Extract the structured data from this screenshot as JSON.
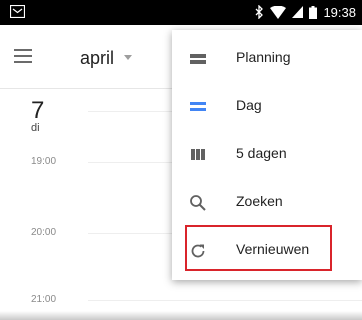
{
  "status_bar": {
    "time": "19:38"
  },
  "header": {
    "month": "april"
  },
  "calendar": {
    "day_number": "7",
    "day_name": "di",
    "times": [
      "19:00",
      "20:00",
      "21:00"
    ]
  },
  "menu": {
    "items": [
      {
        "label": "Planning",
        "icon": "agenda-icon"
      },
      {
        "label": "Dag",
        "icon": "day-view-icon"
      },
      {
        "label": "5 dagen",
        "icon": "five-day-view-icon"
      },
      {
        "label": "Zoeken",
        "icon": "search-icon"
      },
      {
        "label": "Vernieuwen",
        "icon": "refresh-icon"
      }
    ]
  },
  "colors": {
    "accent": "#4285f4",
    "highlight": "#d9242b"
  }
}
